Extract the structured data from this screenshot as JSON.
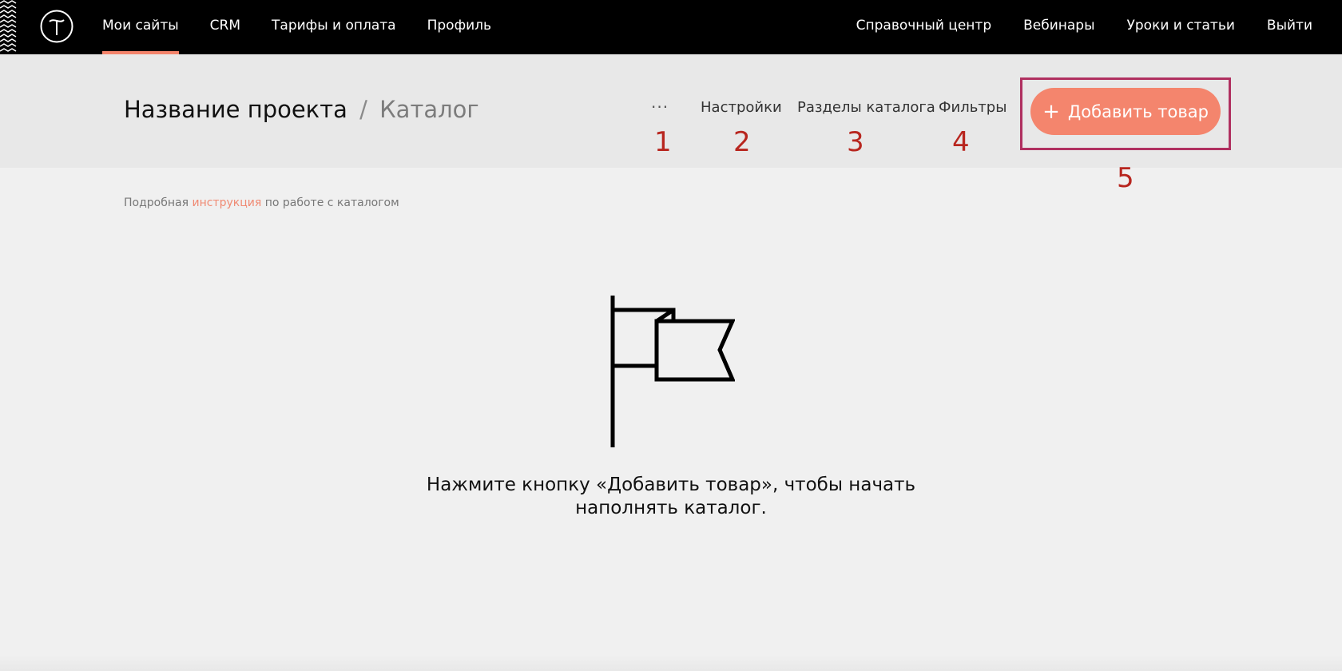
{
  "topbar": {
    "nav_left": [
      "Мои сайты",
      "CRM",
      "Тарифы и оплата",
      "Профиль"
    ],
    "nav_right": [
      "Справочный центр",
      "Вебинары",
      "Уроки и статьи",
      "Выйти"
    ],
    "logo_letter": "T"
  },
  "project": {
    "name": "Название проекта",
    "separator": "/",
    "current": "Каталог",
    "more": "···",
    "settings": "Настройки",
    "sections": "Разделы каталога",
    "filters": "Фильтры",
    "add_button": {
      "plus": "+",
      "label": "Добавить товар"
    }
  },
  "annotations": [
    "1",
    "2",
    "3",
    "4",
    "5"
  ],
  "content": {
    "instruction_before": "Подробная",
    "instruction_link": "инструкция",
    "instruction_after": "по работе с каталогом",
    "empty_line1": "Нажмите кнопку «Добавить товар», чтобы начать",
    "empty_line2": "наполнять каталог."
  },
  "colors": {
    "accent": "#f4856d",
    "annotation": "#b8261f",
    "highlight_frame": "#b03060"
  }
}
